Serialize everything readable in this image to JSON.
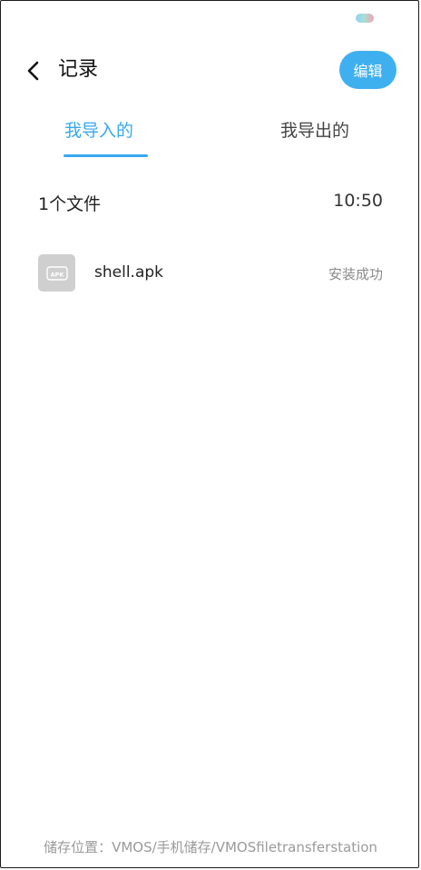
{
  "header": {
    "back_icon": "chevron-left-icon",
    "title": "记录",
    "edit_label": "编辑"
  },
  "tabs": [
    {
      "label": "我导入的",
      "active": true
    },
    {
      "label": "我导出的",
      "active": false
    }
  ],
  "colors": {
    "accent": "#37a8ee",
    "edit_button": "#3fb0ef",
    "icon_bg": "#cfcfcf"
  },
  "groups": [
    {
      "file_count": "1个文件",
      "time": "10:50",
      "items": [
        {
          "icon": "apk-file-icon",
          "icon_text": "APK",
          "name": "shell.apk",
          "status": "安装成功"
        }
      ]
    }
  ],
  "footer": {
    "storage_path": "储存位置：VMOS/手机储存/VMOSfiletransferstation"
  }
}
